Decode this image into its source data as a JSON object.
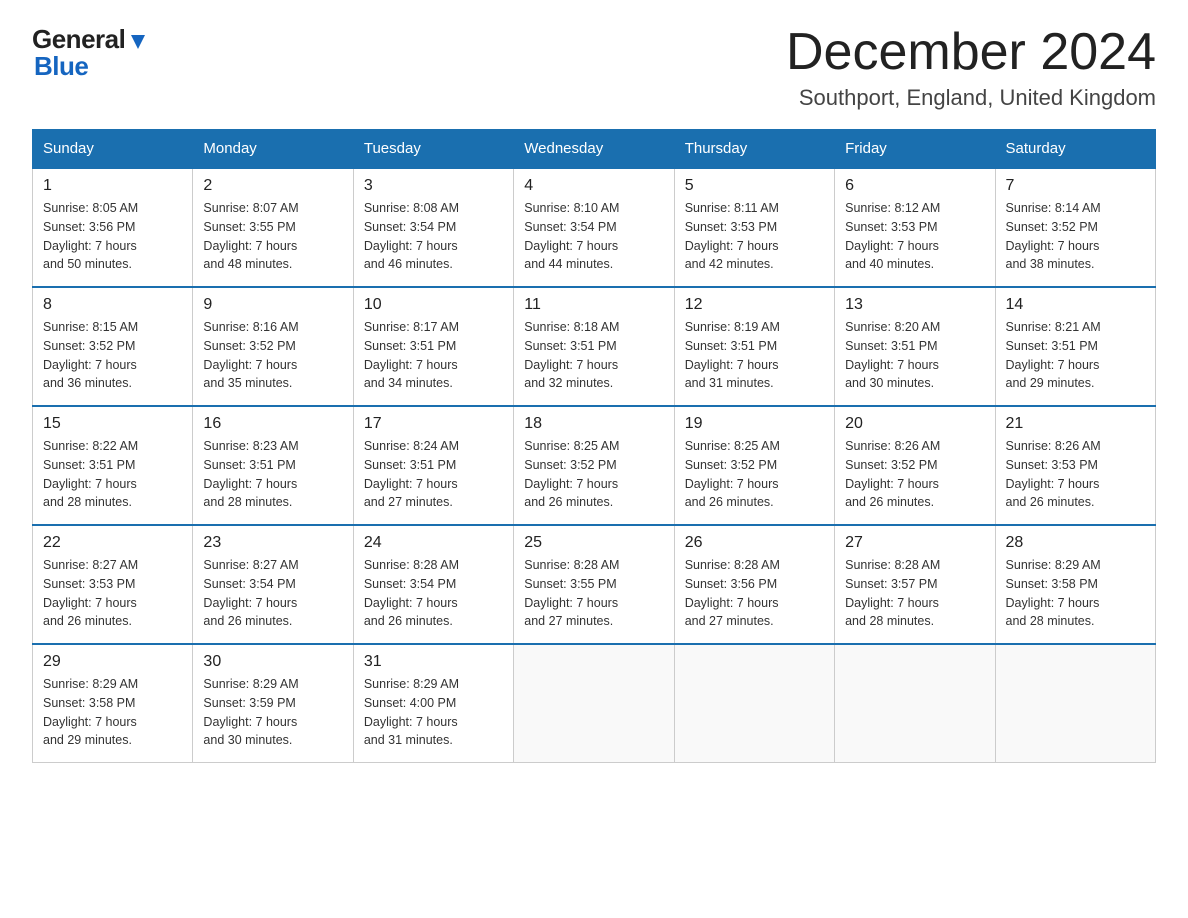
{
  "logo": {
    "general": "General",
    "blue": "Blue"
  },
  "title": "December 2024",
  "subtitle": "Southport, England, United Kingdom",
  "weekdays": [
    "Sunday",
    "Monday",
    "Tuesday",
    "Wednesday",
    "Thursday",
    "Friday",
    "Saturday"
  ],
  "weeks": [
    [
      {
        "day": "1",
        "info": "Sunrise: 8:05 AM\nSunset: 3:56 PM\nDaylight: 7 hours\nand 50 minutes."
      },
      {
        "day": "2",
        "info": "Sunrise: 8:07 AM\nSunset: 3:55 PM\nDaylight: 7 hours\nand 48 minutes."
      },
      {
        "day": "3",
        "info": "Sunrise: 8:08 AM\nSunset: 3:54 PM\nDaylight: 7 hours\nand 46 minutes."
      },
      {
        "day": "4",
        "info": "Sunrise: 8:10 AM\nSunset: 3:54 PM\nDaylight: 7 hours\nand 44 minutes."
      },
      {
        "day": "5",
        "info": "Sunrise: 8:11 AM\nSunset: 3:53 PM\nDaylight: 7 hours\nand 42 minutes."
      },
      {
        "day": "6",
        "info": "Sunrise: 8:12 AM\nSunset: 3:53 PM\nDaylight: 7 hours\nand 40 minutes."
      },
      {
        "day": "7",
        "info": "Sunrise: 8:14 AM\nSunset: 3:52 PM\nDaylight: 7 hours\nand 38 minutes."
      }
    ],
    [
      {
        "day": "8",
        "info": "Sunrise: 8:15 AM\nSunset: 3:52 PM\nDaylight: 7 hours\nand 36 minutes."
      },
      {
        "day": "9",
        "info": "Sunrise: 8:16 AM\nSunset: 3:52 PM\nDaylight: 7 hours\nand 35 minutes."
      },
      {
        "day": "10",
        "info": "Sunrise: 8:17 AM\nSunset: 3:51 PM\nDaylight: 7 hours\nand 34 minutes."
      },
      {
        "day": "11",
        "info": "Sunrise: 8:18 AM\nSunset: 3:51 PM\nDaylight: 7 hours\nand 32 minutes."
      },
      {
        "day": "12",
        "info": "Sunrise: 8:19 AM\nSunset: 3:51 PM\nDaylight: 7 hours\nand 31 minutes."
      },
      {
        "day": "13",
        "info": "Sunrise: 8:20 AM\nSunset: 3:51 PM\nDaylight: 7 hours\nand 30 minutes."
      },
      {
        "day": "14",
        "info": "Sunrise: 8:21 AM\nSunset: 3:51 PM\nDaylight: 7 hours\nand 29 minutes."
      }
    ],
    [
      {
        "day": "15",
        "info": "Sunrise: 8:22 AM\nSunset: 3:51 PM\nDaylight: 7 hours\nand 28 minutes."
      },
      {
        "day": "16",
        "info": "Sunrise: 8:23 AM\nSunset: 3:51 PM\nDaylight: 7 hours\nand 28 minutes."
      },
      {
        "day": "17",
        "info": "Sunrise: 8:24 AM\nSunset: 3:51 PM\nDaylight: 7 hours\nand 27 minutes."
      },
      {
        "day": "18",
        "info": "Sunrise: 8:25 AM\nSunset: 3:52 PM\nDaylight: 7 hours\nand 26 minutes."
      },
      {
        "day": "19",
        "info": "Sunrise: 8:25 AM\nSunset: 3:52 PM\nDaylight: 7 hours\nand 26 minutes."
      },
      {
        "day": "20",
        "info": "Sunrise: 8:26 AM\nSunset: 3:52 PM\nDaylight: 7 hours\nand 26 minutes."
      },
      {
        "day": "21",
        "info": "Sunrise: 8:26 AM\nSunset: 3:53 PM\nDaylight: 7 hours\nand 26 minutes."
      }
    ],
    [
      {
        "day": "22",
        "info": "Sunrise: 8:27 AM\nSunset: 3:53 PM\nDaylight: 7 hours\nand 26 minutes."
      },
      {
        "day": "23",
        "info": "Sunrise: 8:27 AM\nSunset: 3:54 PM\nDaylight: 7 hours\nand 26 minutes."
      },
      {
        "day": "24",
        "info": "Sunrise: 8:28 AM\nSunset: 3:54 PM\nDaylight: 7 hours\nand 26 minutes."
      },
      {
        "day": "25",
        "info": "Sunrise: 8:28 AM\nSunset: 3:55 PM\nDaylight: 7 hours\nand 27 minutes."
      },
      {
        "day": "26",
        "info": "Sunrise: 8:28 AM\nSunset: 3:56 PM\nDaylight: 7 hours\nand 27 minutes."
      },
      {
        "day": "27",
        "info": "Sunrise: 8:28 AM\nSunset: 3:57 PM\nDaylight: 7 hours\nand 28 minutes."
      },
      {
        "day": "28",
        "info": "Sunrise: 8:29 AM\nSunset: 3:58 PM\nDaylight: 7 hours\nand 28 minutes."
      }
    ],
    [
      {
        "day": "29",
        "info": "Sunrise: 8:29 AM\nSunset: 3:58 PM\nDaylight: 7 hours\nand 29 minutes."
      },
      {
        "day": "30",
        "info": "Sunrise: 8:29 AM\nSunset: 3:59 PM\nDaylight: 7 hours\nand 30 minutes."
      },
      {
        "day": "31",
        "info": "Sunrise: 8:29 AM\nSunset: 4:00 PM\nDaylight: 7 hours\nand 31 minutes."
      },
      {
        "day": "",
        "info": ""
      },
      {
        "day": "",
        "info": ""
      },
      {
        "day": "",
        "info": ""
      },
      {
        "day": "",
        "info": ""
      }
    ]
  ]
}
